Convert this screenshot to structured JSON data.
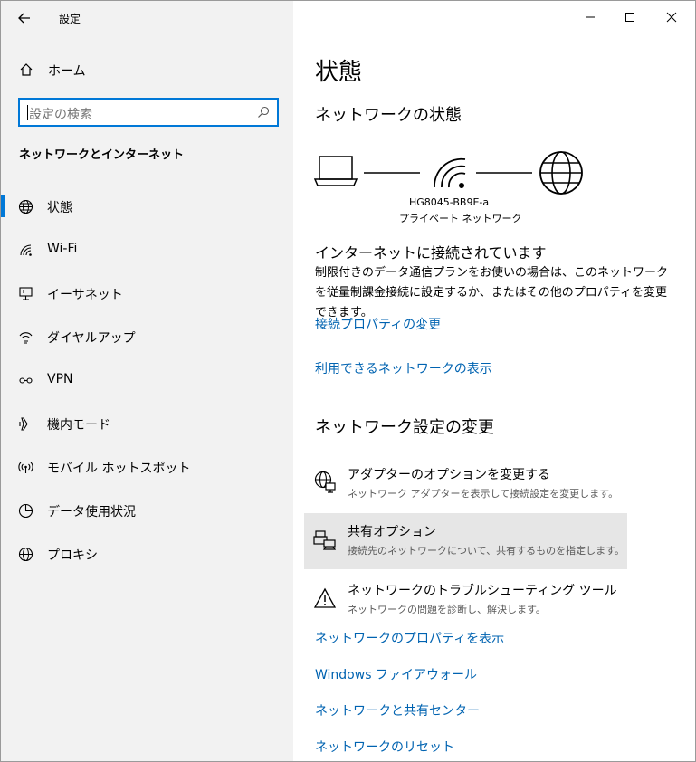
{
  "app": {
    "title": "設定"
  },
  "left": {
    "home_label": "ホーム",
    "search_placeholder": "設定の検索",
    "section_title": "ネットワークとインターネット",
    "nav": [
      {
        "label": "状態",
        "icon": "globe-icon",
        "selected": true
      },
      {
        "label": "Wi-Fi",
        "icon": "wifi-icon",
        "selected": false
      },
      {
        "label": "イーサネット",
        "icon": "ethernet-icon",
        "selected": false
      },
      {
        "label": "ダイヤルアップ",
        "icon": "dialup-icon",
        "selected": false
      },
      {
        "label": "VPN",
        "icon": "vpn-icon",
        "selected": false
      },
      {
        "label": "機内モード",
        "icon": "airplane-icon",
        "selected": false
      },
      {
        "label": "モバイル ホットスポット",
        "icon": "hotspot-icon",
        "selected": false
      },
      {
        "label": "データ使用状況",
        "icon": "data-usage-icon",
        "selected": false
      },
      {
        "label": "プロキシ",
        "icon": "proxy-globe-icon",
        "selected": false
      }
    ]
  },
  "main": {
    "page_title": "状態",
    "network_status_heading": "ネットワークの状態",
    "router_name": "HG8045-BB9E-a",
    "network_type": "プライベート ネットワーク",
    "connection_status": "インターネットに接続されています",
    "description": "制限付きのデータ通信プランをお使いの場合は、このネットワークを従量制課金接続に設定するか、またはその他のプロパティを変更できます。",
    "link_change_connection_props": "接続プロパティの変更",
    "link_show_available_networks": "利用できるネットワークの表示",
    "change_settings_heading": "ネットワーク設定の変更",
    "options": [
      {
        "title": "アダプターのオプションを変更する",
        "subtitle": "ネットワーク アダプターを表示して接続設定を変更します。"
      },
      {
        "title": "共有オプション",
        "subtitle": "接続先のネットワークについて、共有するものを指定します。"
      },
      {
        "title": "ネットワークのトラブルシューティング ツール",
        "subtitle": "ネットワークの問題を診断し、解決します。"
      }
    ],
    "link_network_properties": "ネットワークのプロパティを表示",
    "link_firewall": "Windows ファイアウォール",
    "link_sharing_center": "ネットワークと共有センター",
    "link_network_reset": "ネットワークのリセット"
  },
  "colors": {
    "accent": "#0078d7",
    "link": "#0063b1",
    "left_bg": "#f2f2f2",
    "hover_bg": "#e6e6e6"
  }
}
